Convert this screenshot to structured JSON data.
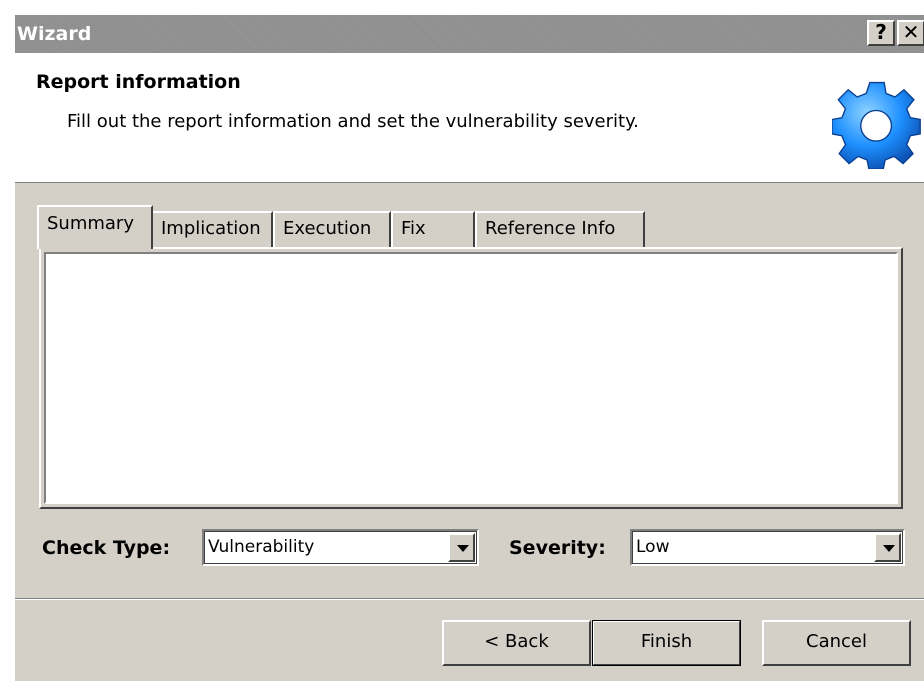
{
  "window": {
    "title": "Wizard",
    "help_glyph": "?",
    "close_glyph": "✕"
  },
  "header": {
    "title": "Report information",
    "subtitle": "Fill out the report information and set the vulnerability severity.",
    "icon": "gear-icon",
    "icon_color": "#1e90ff"
  },
  "tabs": [
    {
      "label": "Summary",
      "active": true
    },
    {
      "label": "Implication",
      "active": false
    },
    {
      "label": "Execution",
      "active": false
    },
    {
      "label": "Fix",
      "active": false
    },
    {
      "label": "Reference Info",
      "active": false
    }
  ],
  "summary_text": "",
  "check_type": {
    "label": "Check Type:",
    "value": "Vulnerability"
  },
  "severity": {
    "label": "Severity:",
    "value": "Low"
  },
  "buttons": {
    "back": "< Back",
    "finish": "Finish",
    "cancel": "Cancel"
  }
}
